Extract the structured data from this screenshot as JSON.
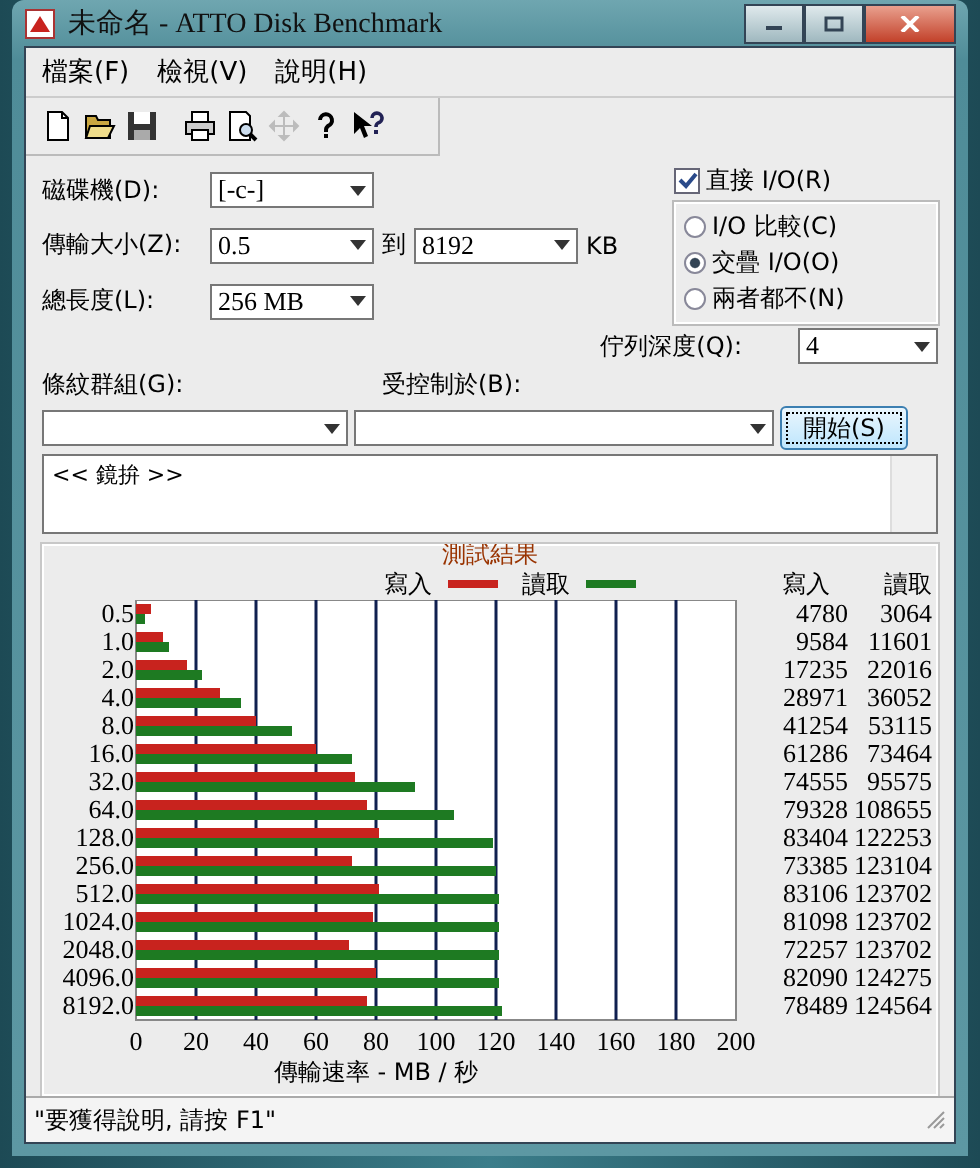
{
  "window": {
    "title": "未命名 - ATTO Disk Benchmark"
  },
  "menu": [
    {
      "label": "檔案(F)"
    },
    {
      "label": "檢視(V)"
    },
    {
      "label": "說明(H)"
    }
  ],
  "toolbar": [
    {
      "kind": "new",
      "disabled": false
    },
    {
      "kind": "open",
      "disabled": false
    },
    {
      "kind": "save",
      "disabled": false
    },
    {
      "kind": "print",
      "disabled": false
    },
    {
      "kind": "preview",
      "disabled": false
    },
    {
      "kind": "move",
      "disabled": true
    },
    {
      "kind": "help",
      "disabled": false
    },
    {
      "kind": "context_help",
      "disabled": false
    }
  ],
  "form": {
    "drive": {
      "label": "磁碟機(D):",
      "value": "[-c-]"
    },
    "transfer_size": {
      "label": "傳輸大小(Z):",
      "from": "0.5",
      "to_label": "到",
      "to": "8192",
      "unit": "KB"
    },
    "total_length": {
      "label": "總長度(L):",
      "value": "256 MB"
    },
    "direct_io": {
      "label": "直接 I/O(R)",
      "checked": true
    },
    "io_modes": [
      {
        "label": "I/O 比較(C)",
        "selected": false
      },
      {
        "label": "交疊 I/O(O)",
        "selected": true
      },
      {
        "label": "兩者都不(N)",
        "selected": false
      }
    ],
    "queue_depth": {
      "label": "佇列深度(Q):",
      "value": "4"
    },
    "stripe_group": {
      "label": "條紋群組(G):"
    },
    "controlled_by": {
      "label": "受控制於(B):"
    },
    "start_button": "開始(S)",
    "description": "<< 鏡拚 >>"
  },
  "results": {
    "title": "測試結果",
    "columns": [
      "寫入",
      "讀取"
    ],
    "rows": [
      {
        "write": "4780",
        "read": "3064"
      },
      {
        "write": "9584",
        "read": "11601"
      },
      {
        "write": "17235",
        "read": "22016"
      },
      {
        "write": "28971",
        "read": "36052"
      },
      {
        "write": "41254",
        "read": "53115"
      },
      {
        "write": "61286",
        "read": "73464"
      },
      {
        "write": "74555",
        "read": "95575"
      },
      {
        "write": "79328",
        "read": "108655"
      },
      {
        "write": "83404",
        "read": "122253"
      },
      {
        "write": "73385",
        "read": "123104"
      },
      {
        "write": "83106",
        "read": "123702"
      },
      {
        "write": "81098",
        "read": "123702"
      },
      {
        "write": "72257",
        "read": "123702"
      },
      {
        "write": "82090",
        "read": "124275"
      },
      {
        "write": "78489",
        "read": "124564"
      }
    ],
    "chart_data": {
      "type": "bar",
      "orientation": "horizontal",
      "xlabel": "傳輸速率 - MB / 秒",
      "categories": [
        "0.5",
        "1.0",
        "2.0",
        "4.0",
        "8.0",
        "16.0",
        "32.0",
        "64.0",
        "128.0",
        "256.0",
        "512.0",
        "1024.0",
        "2048.0",
        "4096.0",
        "8192.0"
      ],
      "series": [
        {
          "name": "寫入",
          "color": "#c8231e",
          "values": [
            5,
            9,
            17,
            28,
            40,
            60,
            73,
            77,
            81,
            72,
            81,
            79,
            71,
            80,
            77
          ]
        },
        {
          "name": "讀取",
          "color": "#1e7a22",
          "values": [
            3,
            11,
            22,
            35,
            52,
            72,
            93,
            106,
            119,
            120,
            121,
            121,
            121,
            121,
            122
          ]
        }
      ],
      "grid": true,
      "xlim": [
        0,
        200
      ],
      "xticks": [
        0,
        20,
        40,
        60,
        80,
        100,
        120,
        140,
        160,
        180,
        200
      ]
    }
  },
  "status_bar": {
    "text": "\"要獲得說明, 請按 F1\""
  }
}
